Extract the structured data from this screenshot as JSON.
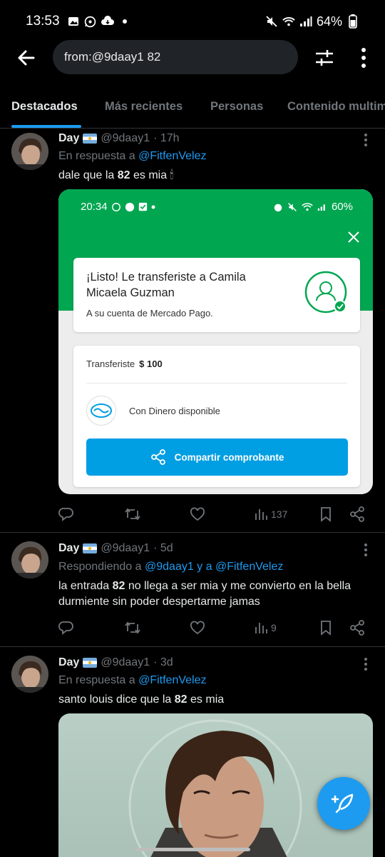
{
  "status_bar": {
    "time": "13:53",
    "battery": "64%"
  },
  "search": {
    "query": "from:@9daay1 82"
  },
  "tabs": [
    {
      "label": "Destacados"
    },
    {
      "label": "Más recientes"
    },
    {
      "label": "Personas"
    },
    {
      "label": "Contenido multimedia"
    }
  ],
  "tweets": [
    {
      "name": "Day",
      "handle": "@9daay1",
      "time": "· 17h",
      "reply_prefix": "En respuesta a",
      "reply_mentions": "@FitfenVelez",
      "text_before": "dale que la ",
      "text_bold": "82",
      "text_after": " es mia 🕯",
      "views": "137"
    },
    {
      "name": "Day",
      "handle": "@9daay1",
      "time": "· 5d",
      "reply_prefix": "Respondiendo a",
      "reply_mentions": "@9daay1 y a @FitfenVelez",
      "text_before": "la entrada ",
      "text_bold": "82",
      "text_after": " no llega a ser mia y me convierto en la bella durmiente sin poder despertarme jamas",
      "views": "9"
    },
    {
      "name": "Day",
      "handle": "@9daay1",
      "time": "· 3d",
      "reply_prefix": "En respuesta a",
      "reply_mentions": "@FitfenVelez",
      "text_before": "santo louis dice que la ",
      "text_bold": "82",
      "text_after": " es mia"
    }
  ],
  "embedded_receipt": {
    "time": "20:34",
    "battery": "60%",
    "title": "¡Listo! Le transferiste a Camila Micaela Guzman",
    "subtitle": "A su cuenta de Mercado Pago.",
    "transfer_label": "Transferiste",
    "amount": "$ 100",
    "method": "Con Dinero disponible",
    "share_button": "Compartir comprobante"
  },
  "colors": {
    "accent": "#1d9bf0",
    "mp_green": "#00a650",
    "mp_blue": "#009ee3"
  }
}
